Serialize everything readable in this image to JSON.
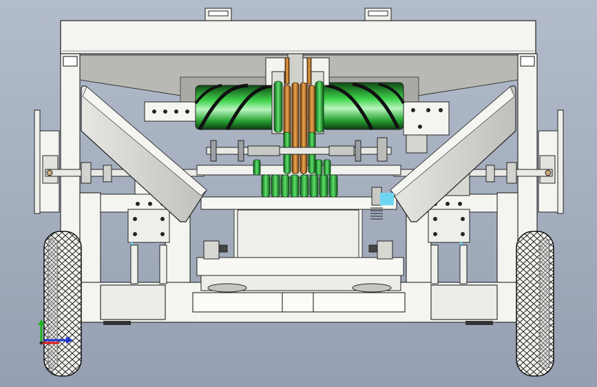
{
  "viewport": {
    "background_top": "#b3bccb",
    "background_bottom": "#959fb1"
  },
  "model": {
    "frame_color": "#f2f2ee",
    "hopper_color": "#d4d5d0",
    "edge_color": "#222222",
    "roller_green": "#2eb83a",
    "roller_dark": "#1a1a1a",
    "copper_color": "#c87a2a",
    "cylinder_color": "#cfd0cb",
    "blue_accent": "#6fd6f2"
  },
  "triad": {
    "x_axis_color": "#e01b1b",
    "y_axis_color": "#1bb51b",
    "z_axis_color": "#1b35d6"
  }
}
